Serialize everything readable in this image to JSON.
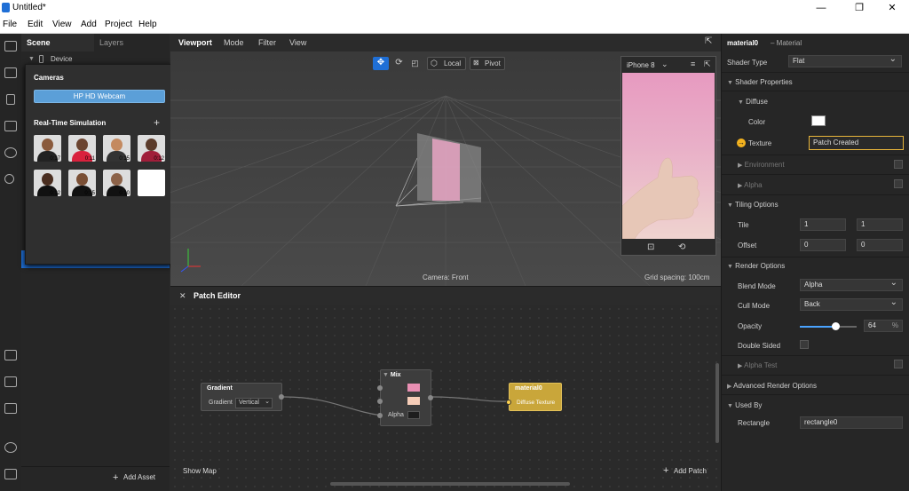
{
  "window": {
    "title": "Untitled*",
    "minimize": "—",
    "restore": "❐",
    "close": "✕"
  },
  "menu": [
    "File",
    "Edit",
    "View",
    "Add",
    "Project",
    "Help"
  ],
  "scene_panel": {
    "tab_scene": "Scene",
    "tab_layers": "Layers",
    "device_label": "Device",
    "add_asset": "Add Asset"
  },
  "cameras_popup": {
    "title": "Cameras",
    "webcam": "HP HD Webcam",
    "sim_title": "Real-Time Simulation",
    "add_icon": "+",
    "faces": [
      "0:17",
      "0:11",
      "0:15",
      "0:12",
      "0:12",
      "0:15",
      "0:10",
      ""
    ]
  },
  "viewport": {
    "tab": "Viewport",
    "menu": [
      "Mode",
      "Filter",
      "View"
    ],
    "local_label": "Local",
    "pivot_label": "Pivot",
    "camera_label": "Camera: Front",
    "grid_label": "Grid spacing: 100cm",
    "device": "iPhone 8"
  },
  "patch_editor": {
    "title": "Patch Editor",
    "show_map": "Show Map",
    "add_patch": "Add Patch",
    "gradient_node": {
      "title": "Gradient",
      "field_label": "Gradient",
      "value": "Vertical"
    },
    "mix_node": {
      "title": "Mix",
      "alpha_label": "Alpha",
      "color1": "#e98fb3",
      "color2": "#f6cdb8",
      "color3": "#1e1e1e"
    },
    "material_node": {
      "title": "material0",
      "port": "Diffuse Texture"
    }
  },
  "properties": {
    "title": "material0",
    "subtitle": "– Material",
    "shader_type_label": "Shader Type",
    "shader_type_value": "Flat",
    "shader_properties": "Shader Properties",
    "diffuse": "Diffuse",
    "color_label": "Color",
    "texture_label": "Texture",
    "texture_value": "Patch Created",
    "environment": "Environment",
    "alpha": "Alpha",
    "tiling_options": "Tiling Options",
    "tile_label": "Tile",
    "tile_x": "1",
    "tile_y": "1",
    "offset_label": "Offset",
    "offset_x": "0",
    "offset_y": "0",
    "render_options": "Render Options",
    "blend_mode_label": "Blend Mode",
    "blend_mode_value": "Alpha",
    "cull_mode_label": "Cull Mode",
    "cull_mode_value": "Back",
    "opacity_label": "Opacity",
    "opacity_value": "64",
    "opacity_unit": "%",
    "double_sided": "Double Sided",
    "alpha_test": "Alpha Test",
    "advanced_render": "Advanced Render Options",
    "used_by": "Used By",
    "rectangle_label": "Rectangle",
    "rectangle_value": "rectangle0"
  }
}
